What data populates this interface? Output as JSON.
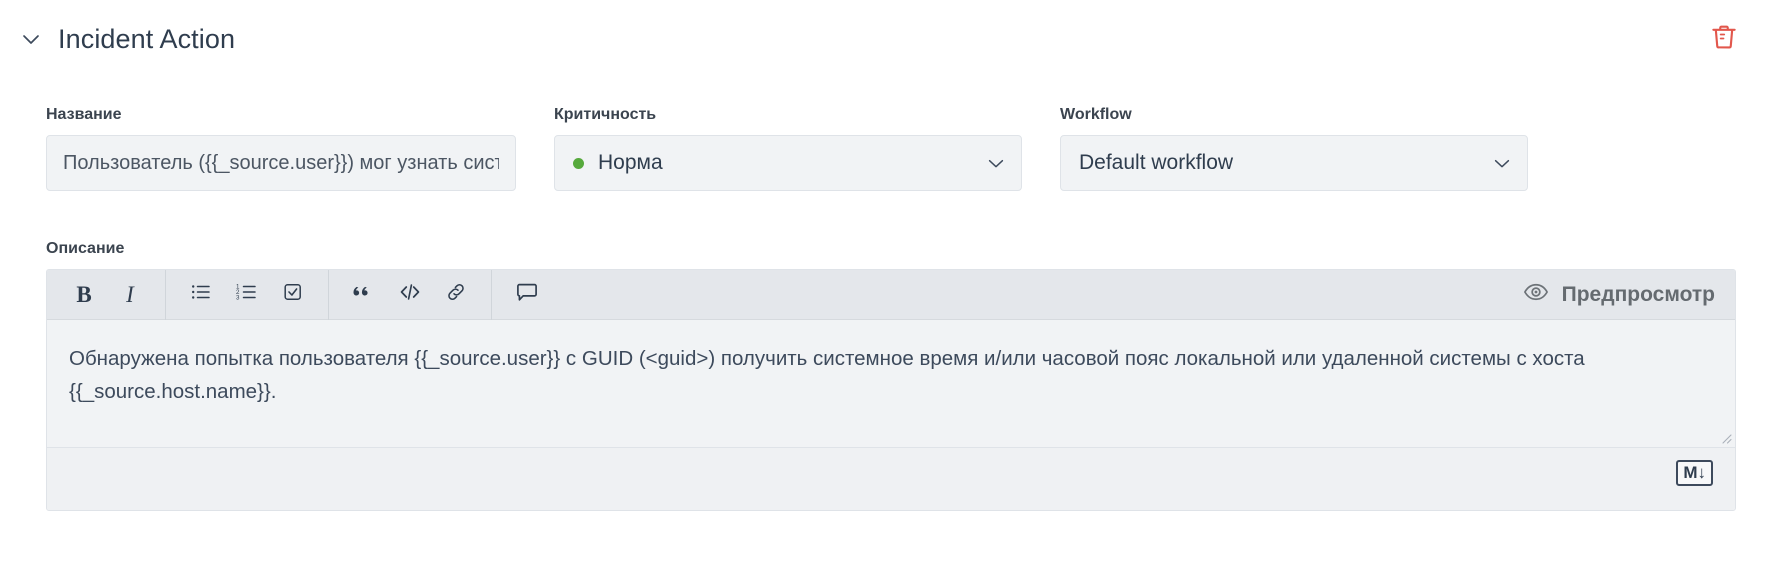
{
  "section": {
    "title": "Incident Action",
    "collapse_icon": "chevron-down-icon",
    "delete_icon": "trash-icon"
  },
  "fields": {
    "name": {
      "label": "Название",
      "value": "Пользователь ({{_source.user}}) мог узнать системное время",
      "placeholder": "Название"
    },
    "criticality": {
      "label": "Критичность",
      "value": "Норма",
      "dot_color": "#56a93c",
      "caret_icon": "chevron-down-icon"
    },
    "workflow": {
      "label": "Workflow",
      "value": "Default workflow",
      "caret_icon": "chevron-down-icon"
    }
  },
  "description": {
    "label": "Описание",
    "toolbar": {
      "bold": "B",
      "italic": "I",
      "bullet_list": "bullet-list-icon",
      "numbered_list": "numbered-list-icon",
      "task_list": "checkbox-list-icon",
      "quote": "blockquote-icon",
      "code": "code-icon",
      "link": "link-icon",
      "comment": "comment-icon",
      "preview_label": "Предпросмотр",
      "preview_icon": "eye-icon"
    },
    "body": "Обнаружена попытка пользователя {{_source.user}} с GUID (<guid>) получить системное время и/или часовой пояс локальной или удаленной системы с хоста {{_source.host.name}}.",
    "markdown_badge": "M↓"
  }
}
